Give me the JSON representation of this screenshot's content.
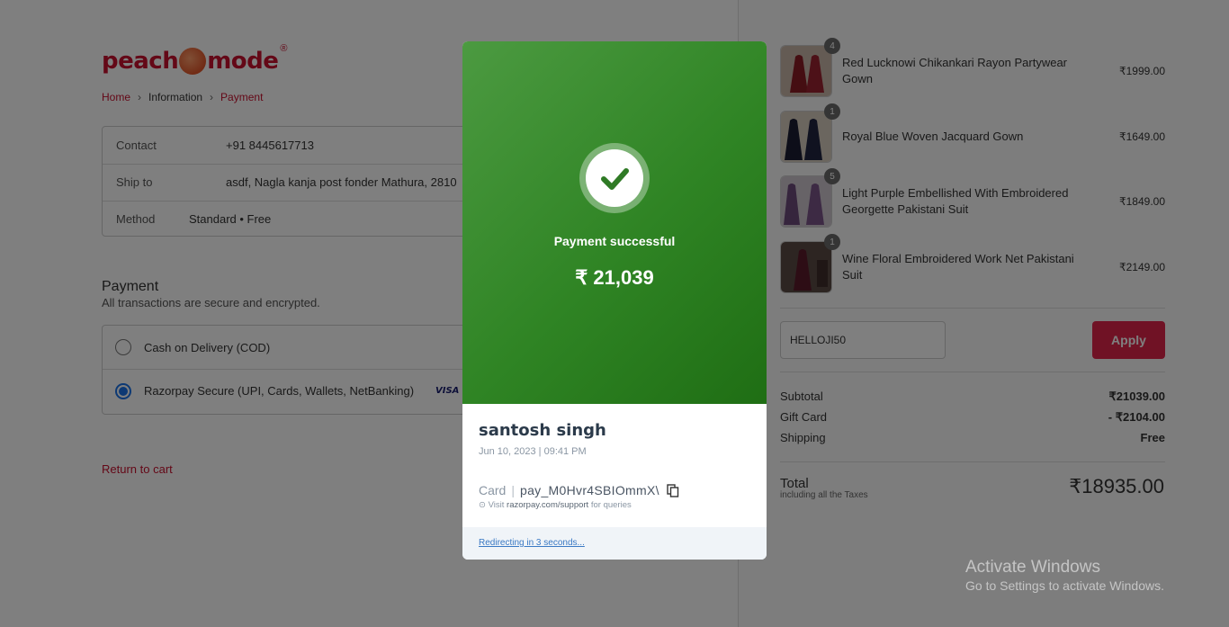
{
  "logo": {
    "text_left": "peach",
    "text_right": "mode",
    "reg": "®"
  },
  "breadcrumb": {
    "home": "Home",
    "info": "Information",
    "payment": "Payment"
  },
  "info": {
    "contact_label": "Contact",
    "contact_value": "+91 8445617713",
    "ship_label": "Ship to",
    "ship_value": "asdf, Nagla kanja post fonder Mathura, 2810",
    "method_label": "Method",
    "method_value": "Standard • Free"
  },
  "payment": {
    "title": "Payment",
    "subtitle": "All transactions are secure and encrypted.",
    "options": [
      {
        "label": "Cash on Delivery (COD)",
        "selected": false
      },
      {
        "label": "Razorpay Secure (UPI, Cards, Wallets, NetBanking)",
        "selected": true
      }
    ],
    "visa": "VISA",
    "return": "Return to cart"
  },
  "cart": {
    "items": [
      {
        "qty": "4",
        "name": "Red Lucknowi Chikankari Rayon Partywear Gown",
        "price": "₹1999.00",
        "color": "#8a1c24"
      },
      {
        "qty": "1",
        "name": "Royal Blue Woven Jacquard Gown",
        "price": "₹1649.00",
        "color": "#1a1d33"
      },
      {
        "qty": "5",
        "name": "Light Purple Embellished With Embroidered Georgette Pakistani Suit",
        "price": "₹1849.00",
        "color": "#6c4a7a"
      },
      {
        "qty": "1",
        "name": "Wine Floral Embroidered Work Net Pakistani Suit",
        "price": "₹2149.00",
        "color": "#5a1a2a"
      }
    ],
    "coupon_value": "HELLOJI50",
    "apply_label": "Apply",
    "subtotal_label": "Subtotal",
    "subtotal_value": "₹21039.00",
    "giftcard_label": "Gift Card",
    "giftcard_value": "- ₹2104.00",
    "shipping_label": "Shipping",
    "shipping_value": "Free",
    "total_label": "Total",
    "total_sub": "including all the Taxes",
    "total_value": "₹18935.00"
  },
  "modal": {
    "status": "Payment successful",
    "amount": "₹ 21,039",
    "customer": "santosh singh",
    "date": "Jun 10, 2023 | 09:41 PM",
    "method": "Card",
    "payment_id": "pay_M0Hvr4SBIOmmX\\",
    "support_prefix": "Visit",
    "support_domain": "razorpay.com/support",
    "support_suffix": "for queries",
    "redirect": "Redirecting in 3 seconds..."
  },
  "windows": {
    "line1": "Activate Windows",
    "line2": "Go to Settings to activate Windows."
  }
}
